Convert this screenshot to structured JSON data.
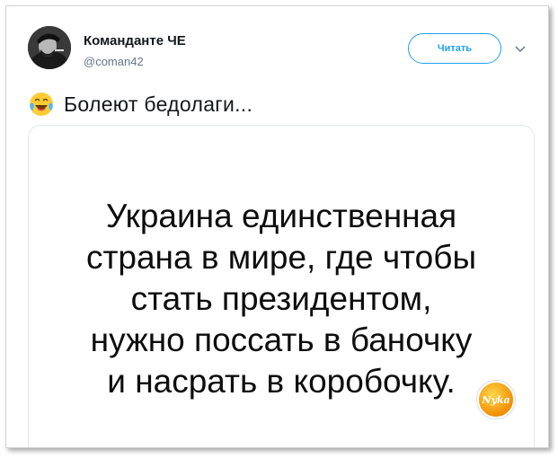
{
  "author": {
    "display_name": "Команданте ЧЕ",
    "handle": "@coman42"
  },
  "follow_button": {
    "label": "Читать"
  },
  "tweet": {
    "text": "Болеют бедолаги..."
  },
  "media": {
    "lines": [
      "Украина единственная",
      "страна в мире, где чтобы",
      "стать президентом,",
      "нужно поссать в баночку",
      "и насрать в коробочку."
    ],
    "watermark": "Nyka"
  },
  "colors": {
    "accent": "#1da1f2",
    "handle": "#657786",
    "text": "#14171a"
  },
  "icons": {
    "emoji": "face-with-tears-of-joy-icon",
    "menu": "chevron-down-icon"
  }
}
